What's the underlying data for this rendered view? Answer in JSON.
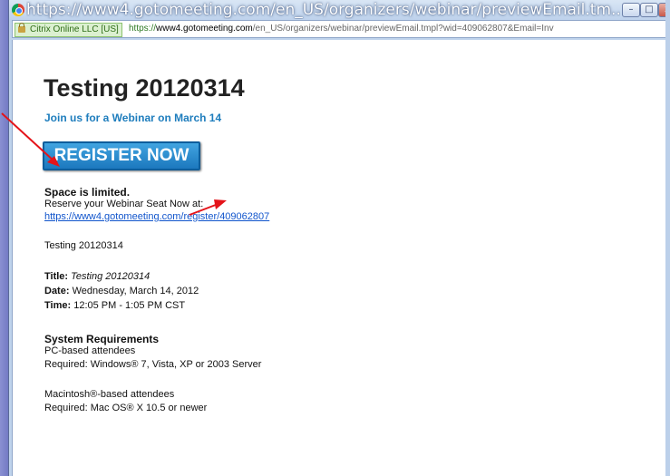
{
  "window": {
    "title": "https://www4.gotomeeting.com/en_US/organizers/webinar/previewEmail.tm...",
    "controls": {
      "minimize": "–",
      "maximize": "□",
      "close": "x"
    }
  },
  "address_bar": {
    "certificate": "Citrix Online LLC [US]",
    "url_scheme": "https://",
    "url_host": "www4.gotomeeting.com",
    "url_path": "/en_US/organizers/webinar/previewEmail.tmpl?wid=409062807&Email=Inv"
  },
  "email": {
    "title": "Testing 20120314",
    "subtitle": "Join us for a Webinar on March 14",
    "register_button": "REGISTER NOW",
    "space_limited": "Space is limited.",
    "reserve_text": "Reserve your Webinar Seat Now at:",
    "register_link": "https://www4.gotomeeting.com/register/409062807",
    "description": "Testing 20120314",
    "details": {
      "title_label": "Title:",
      "title_value": "Testing 20120314",
      "date_label": "Date:",
      "date_value": "Wednesday, March 14, 2012",
      "time_label": "Time:",
      "time_value": "12:05 PM - 1:05 PM CST"
    },
    "requirements": {
      "heading": "System Requirements",
      "pc_line1": "PC-based attendees",
      "pc_line2": "Required: Windows® 7, Vista, XP or 2003 Server",
      "mac_line1": "Macintosh®-based attendees",
      "mac_line2": "Required: Mac OS® X 10.5 or newer"
    }
  },
  "colors": {
    "annotation_arrow": "#e4141a",
    "link": "#1155cc",
    "subtitle": "#1e7dbd",
    "button": "#2b8fd3"
  }
}
